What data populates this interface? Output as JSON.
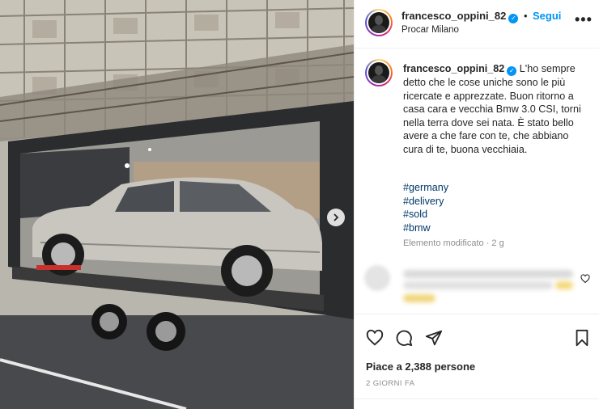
{
  "post": {
    "username": "francesco_oppini_82",
    "dot": "•",
    "follow_label": "Segui",
    "location": "Procar Milano",
    "more_label": "•••"
  },
  "caption": {
    "username": "francesco_oppini_82",
    "text": "L'ho sempre detto che le cose uniche sono le più ricercate e apprezzate. Buon ritorno a casa cara e vecchia Bmw 3.0 CSI, torni nella terra dove sei nata. È stato bello avere a che fare con te, che abbiano cura di te, buona vecchiaia.",
    "hashtags": [
      "#germany",
      "#delivery",
      "#sold",
      "#bmw"
    ],
    "edited": "Elemento modificato · 2 g"
  },
  "engagement": {
    "likes": "Piace a 2,388 persone",
    "time_ago": "2 GIORNI FA"
  },
  "icons": {
    "verified": "verified-badge-icon",
    "like": "heart-icon",
    "comment": "comment-icon",
    "share": "paper-plane-icon",
    "save": "bookmark-icon",
    "next": "chevron-right-icon"
  },
  "colors": {
    "accent": "#0095f6",
    "link": "#00376b",
    "muted": "#8e8e8e",
    "text": "#262626"
  }
}
